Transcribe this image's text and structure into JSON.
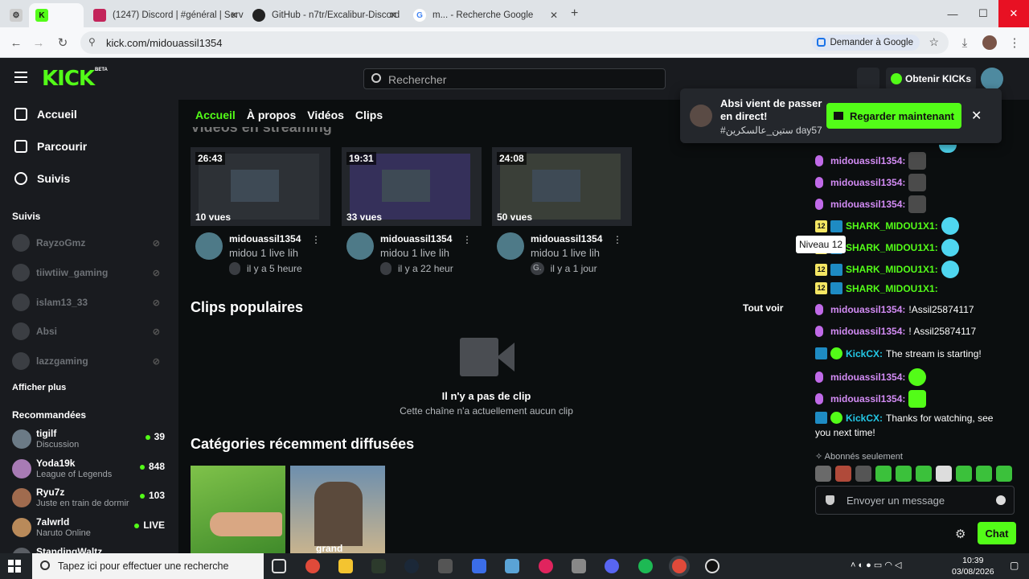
{
  "browser": {
    "tabs": [
      {
        "label": "",
        "favicon": "settings-icon"
      },
      {
        "label": "",
        "favicon": "kick-favicon"
      },
      {
        "label": "(1247) Discord | #général | Serv",
        "favicon": "discord-favicon"
      },
      {
        "label": "GitHub - n7tr/Excalibur-Discord",
        "favicon": "github-favicon"
      },
      {
        "label": "m... - Recherche Google",
        "favicon": "google-favicon"
      }
    ],
    "url": "kick.com/midouassil1354",
    "ask_google": "Demander à Google"
  },
  "header": {
    "logo": "KICK",
    "beta": "BETA",
    "search_placeholder": "Rechercher",
    "get_kicks": "Obtenir KICKs"
  },
  "sidebar": {
    "nav": [
      {
        "label": "Accueil",
        "icon": "home-icon"
      },
      {
        "label": "Parcourir",
        "icon": "browse-icon"
      },
      {
        "label": "Suivis",
        "icon": "heart-icon"
      }
    ],
    "follows_heading": "Suivis",
    "follows": [
      "RayzoGmz",
      "tiiwtiiw_gaming",
      "islam13_33",
      "Absi",
      "lazzgaming"
    ],
    "show_more": "Afficher plus",
    "recommended_heading": "Recommandées",
    "recommended": [
      {
        "name": "tigilf",
        "category": "Discussion",
        "viewers": "39"
      },
      {
        "name": "Yoda19k",
        "category": "League of Legends",
        "viewers": "848"
      },
      {
        "name": "Ryu7z",
        "category": "Juste en train de dormir",
        "viewers": "103"
      },
      {
        "name": "7alwrld",
        "category": "Naruto Online",
        "viewers": "LIVE"
      },
      {
        "name": "StandingWaltz",
        "category": "",
        "viewers": ""
      }
    ]
  },
  "channel": {
    "tabs": [
      "Accueil",
      "À propos",
      "Vidéos",
      "Clips"
    ],
    "videos_heading": "Vidéos en streaming",
    "videos": [
      {
        "duration": "26:43",
        "views": "10 vues",
        "author": "midouassil1354",
        "title": "midou 1 live lih",
        "time_badge": "",
        "time": "il y a 5 heure"
      },
      {
        "duration": "19:31",
        "views": "33 vues",
        "author": "midouassil1354",
        "title": "midou 1 live lih",
        "time_badge": "",
        "time": "il y a 22 heur"
      },
      {
        "duration": "24:08",
        "views": "50 vues",
        "author": "midouassil1354",
        "title": "midou 1 live lih",
        "time_badge": "G.",
        "time": "il y a 1 jour"
      }
    ],
    "clips_heading": "Clips populaires",
    "see_all": "Tout voir",
    "no_clip": "Il n'y a pas de clip",
    "no_clip_sub": "Cette chaîne n'a actuellement aucun clip",
    "categories_heading": "Catégories récemment diffusées",
    "gta_text": "grand"
  },
  "toast": {
    "title": "Absi vient de passer en direct!",
    "subtitle": "#ستين_عالسكرين day57",
    "watch": "Regarder maintenant"
  },
  "tooltip": "Niveau 12",
  "chat": {
    "messages": [
      {
        "type": "mic",
        "user": "midouassil1354:",
        "text": "",
        "emote": "face"
      },
      {
        "type": "mic",
        "user": "midouassil1354:",
        "text": "",
        "emote": "face"
      },
      {
        "type": "mic",
        "user": "midouassil1354:",
        "text": "",
        "emote": "face"
      },
      {
        "type": "lvl",
        "level": "12",
        "user": "SHARK_MIDOU1X1:",
        "text": "",
        "emote": "cat"
      },
      {
        "type": "lvl",
        "level": "12",
        "user": "SHARK_MIDOU1X1:",
        "text": "",
        "emote": "cat"
      },
      {
        "type": "lvl",
        "level": "12",
        "user": "SHARK_MIDOU1X1:",
        "text": "",
        "emote": "cat"
      },
      {
        "type": "lvl",
        "level": "12",
        "user": "SHARK_MIDOU1X1:",
        "text": "",
        "emote": ""
      },
      {
        "type": "mic",
        "user": "midouassil1354:",
        "text": "!Assil25874117",
        "emote": ""
      },
      {
        "type": "mic",
        "user": "midouassil1354:",
        "text": "! Assil25874117",
        "emote": ""
      },
      {
        "type": "kick",
        "user": "KickCX:",
        "text": "The stream is starting!",
        "emote": ""
      },
      {
        "type": "mic",
        "user": "midouassil1354:",
        "text": "",
        "emote": "green"
      },
      {
        "type": "mic",
        "user": "midouassil1354:",
        "text": "",
        "emote": "green"
      },
      {
        "type": "kick",
        "user": "KickCX:",
        "text": "Thanks for watching, see",
        "emote": ""
      }
    ],
    "last_line": "you next time!",
    "sub_only": "Abonnés seulement",
    "input_placeholder": "Envoyer un message",
    "chat_button": "Chat"
  },
  "taskbar": {
    "search_placeholder": "Tapez ici pour effectuer une recherche",
    "time": "10:39",
    "date": "03/08/2026"
  },
  "colors": {
    "kick_green": "#53fc18",
    "chat_purple": "#d38cf5",
    "badge_yellow": "#f5e663"
  }
}
